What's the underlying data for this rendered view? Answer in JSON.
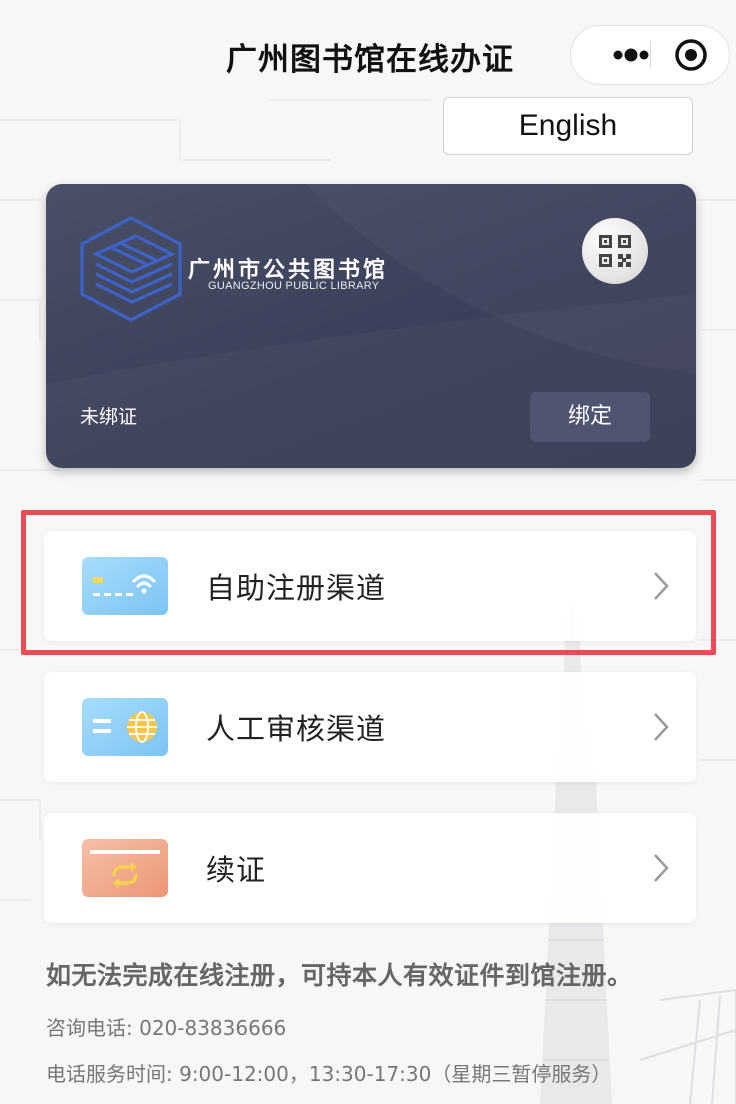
{
  "header": {
    "title": "广州图书馆在线办证",
    "more_icon": "more-dots-icon",
    "close_icon": "target-circle-icon"
  },
  "language_button": "English",
  "card": {
    "library_name_cn": "广州市公共图书馆",
    "library_name_en": "GUANGZHOU PUBLIC LIBRARY",
    "status": "未绑证",
    "bind_button": "绑定",
    "qr_icon": "qr-code-icon"
  },
  "menu": {
    "items": [
      {
        "label": "自助注册渠道",
        "icon": "self-service-card-icon",
        "highlighted": true
      },
      {
        "label": "人工审核渠道",
        "icon": "manual-review-card-icon",
        "highlighted": false
      },
      {
        "label": "续证",
        "icon": "renew-card-icon",
        "highlighted": false
      }
    ]
  },
  "footer": {
    "notice": "如无法完成在线注册，可持本人有效证件到馆注册。",
    "phone": "咨询电话: 020-83836666",
    "hours": "电话服务时间: 9:00-12:00，13:30-17:30（星期三暂停服务）"
  },
  "colors": {
    "card_bg": "#3d425c",
    "highlight_border": "#ec4a55",
    "icon_blue": "#8fd0f6",
    "icon_orange": "#f0a88c"
  }
}
